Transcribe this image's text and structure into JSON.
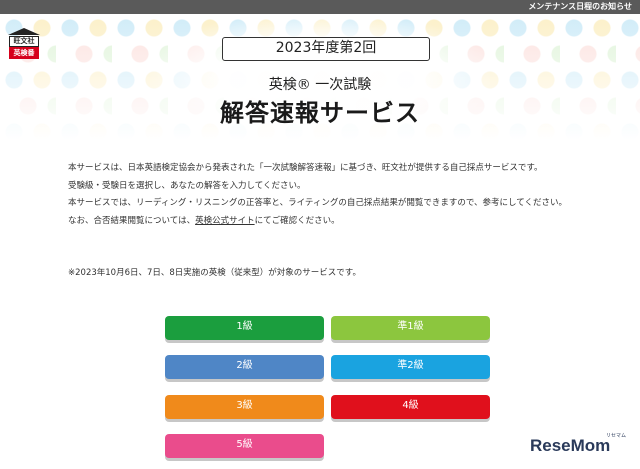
{
  "topbar": {
    "link_text": "メンテナンス日程のお知らせ"
  },
  "logo": {
    "line1": "旺文社",
    "line2": "英検番"
  },
  "header": {
    "year_label": "2023年度第2回",
    "subtitle": "英検® 一次試験",
    "title": "解答速報サービス"
  },
  "description": {
    "line1": "本サービスは、日本英語検定協会から発表された「一次試験解答速報」に基づき、旺文社が提供する自己採点サービスです。",
    "line2": "受験級・受験日を選択し、あなたの解答を入力してください。",
    "line3": "本サービスでは、リーディング・リスニングの正答率と、ライティングの自己採点結果が閲覧できますので、参考にしてください。",
    "line4_prefix": "なお、合否結果閲覧については、",
    "line4_link": "英検公式サイト",
    "line4_suffix": "にてご確認ください。"
  },
  "note": "※2023年10月6日、7日、8日実施の英検（従来型）が対象のサービスです。",
  "grades": {
    "g1": "1級",
    "gp1": "準1級",
    "g2": "2級",
    "gp2": "準2級",
    "g3": "3級",
    "g4": "4級",
    "g5": "5級"
  },
  "colors": {
    "g1": "#1b9e3e",
    "gp1": "#8cc63e",
    "g2": "#4f86c6",
    "gp2": "#1aa3e0",
    "g3": "#f08a1b",
    "g4": "#e0101c",
    "g5": "#ea4c8c"
  },
  "watermark": {
    "text": "ReseMom",
    "sub": "リセマム"
  }
}
